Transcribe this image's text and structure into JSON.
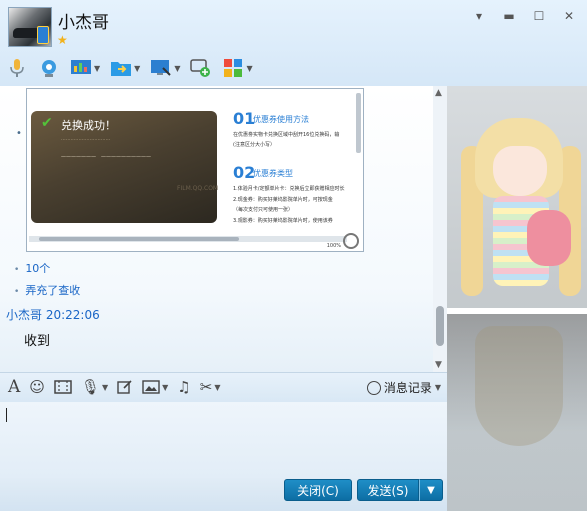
{
  "contact": {
    "name": "小杰哥"
  },
  "window_controls": [
    "minimize",
    "restore",
    "maximize",
    "close"
  ],
  "toolbar": {
    "items": [
      "voice-call",
      "video-call",
      "share-screen",
      "send-file",
      "remote-assist",
      "create-discussion",
      "apps"
    ]
  },
  "shared_image": {
    "success_text": "兑换成功！",
    "watermark": "FILM.QQ.COM",
    "section1_num": "01",
    "section1_title": "优惠券使用方法",
    "section1_lines": [
      "在优惠劵实物卡兑换区域中刮开16位兑换码，输",
      "(注意区分大小写）"
    ],
    "section2_num": "02",
    "section2_title": "优惠券类型",
    "section2_lines": [
      "1.体验月卡/定额单片卡：兑换后立即获赠相应时长",
      "2.现金券：购买好莱坞影院单片时，可按现金",
      "（每次支付只可使用一张）",
      "3.观影券：购买好莱坞影院单片时，使用该券"
    ],
    "zoom_pct": "100%"
  },
  "messages": {
    "line1": "10个",
    "line2": "弄充了查收",
    "sender_time": "小杰哥  20:22:06",
    "received": "收到"
  },
  "input_toolbar": {
    "history_label": "消息记录"
  },
  "buttons": {
    "close_label": "关闭(C)",
    "send_label": "发送(S)"
  },
  "colors": {
    "accent": "#1a66c6",
    "button": "#0d6ea4"
  }
}
